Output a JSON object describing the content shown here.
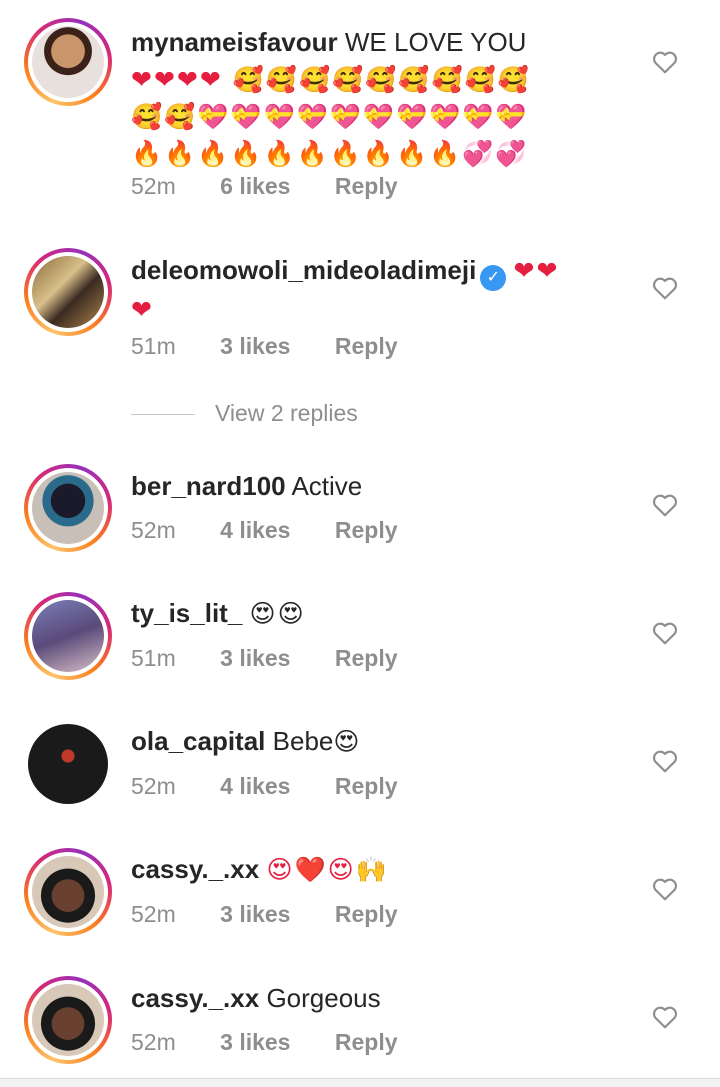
{
  "comments": [
    {
      "username": "mynameisfavour",
      "text": "WE LOVE YOU",
      "emoji": "❤️❤️❤️❤️❤️❤️🥰🥰🥰🥰🥰🥰🥰🥰🥰🥰🥰💝💝💝💝💝💝💝💝💝💝🔥🔥🔥🔥🔥🔥🔥🔥🔥🔥💞💞",
      "time": "52m",
      "likes": "6 likes",
      "reply": "Reply"
    },
    {
      "username": "deleomowoli_mideoladimeji",
      "text": "",
      "emoji": "❤️❤️❤️",
      "time": "51m",
      "likes": "3 likes",
      "reply": "Reply",
      "verified": true
    },
    {
      "username": "ber_nard100",
      "text": "Active",
      "emoji": "",
      "time": "52m",
      "likes": "4 likes",
      "reply": "Reply"
    },
    {
      "username": "ty_is_lit_",
      "text": "",
      "emoji": "😍😍",
      "time": "51m",
      "likes": "3 likes",
      "reply": "Reply"
    },
    {
      "username": "ola_capital",
      "text": "Bebe",
      "emoji": "😍",
      "time": "52m",
      "likes": "4 likes",
      "reply": "Reply"
    },
    {
      "username": "cassy._.xx",
      "text": "",
      "emoji": "😍❤️😍🙌",
      "time": "52m",
      "likes": "3 likes",
      "reply": "Reply"
    },
    {
      "username": "cassy._.xx",
      "text": "Gorgeous",
      "emoji": "",
      "time": "52m",
      "likes": "3 likes",
      "reply": "Reply"
    }
  ],
  "view_replies": "View 2 replies",
  "icons": {
    "like": "heart-outline-icon",
    "verified": "verified-badge-icon"
  },
  "colors": {
    "meta": "#8e8e8e",
    "text": "#262626",
    "verified": "#3897f0",
    "heart": "#e41e3f"
  }
}
